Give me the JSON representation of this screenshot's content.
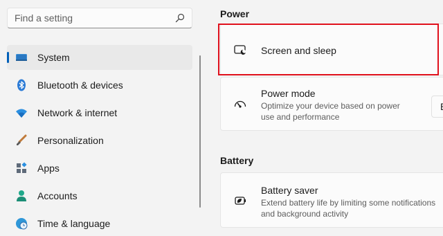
{
  "search": {
    "placeholder": "Find a setting"
  },
  "nav": {
    "items": [
      {
        "label": "System",
        "icon": "system-monitor-icon"
      },
      {
        "label": "Bluetooth & devices",
        "icon": "bluetooth-icon"
      },
      {
        "label": "Network & internet",
        "icon": "wifi-icon"
      },
      {
        "label": "Personalization",
        "icon": "pencil-brush-icon"
      },
      {
        "label": "Apps",
        "icon": "apps-grid-icon"
      },
      {
        "label": "Accounts",
        "icon": "person-icon"
      },
      {
        "label": "Time & language",
        "icon": "globe-clock-icon"
      }
    ],
    "selected_index": 0
  },
  "power": {
    "title": "Power",
    "screen_sleep": {
      "title": "Screen and sleep",
      "icon": "screen-sleep-icon"
    },
    "power_mode": {
      "title": "Power mode",
      "description_line1": "Optimize your device based on power",
      "description_line2": "use and performance",
      "dropdown_value": "B",
      "icon": "gauge-icon"
    }
  },
  "battery": {
    "title": "Battery",
    "battery_saver": {
      "title": "Battery saver",
      "description_line1": "Extend battery life by limiting some notifications",
      "description_line2": "and background activity",
      "icon": "battery-leaf-icon"
    }
  },
  "colors": {
    "accent": "#005fb8",
    "highlight_box": "#e0101c"
  }
}
